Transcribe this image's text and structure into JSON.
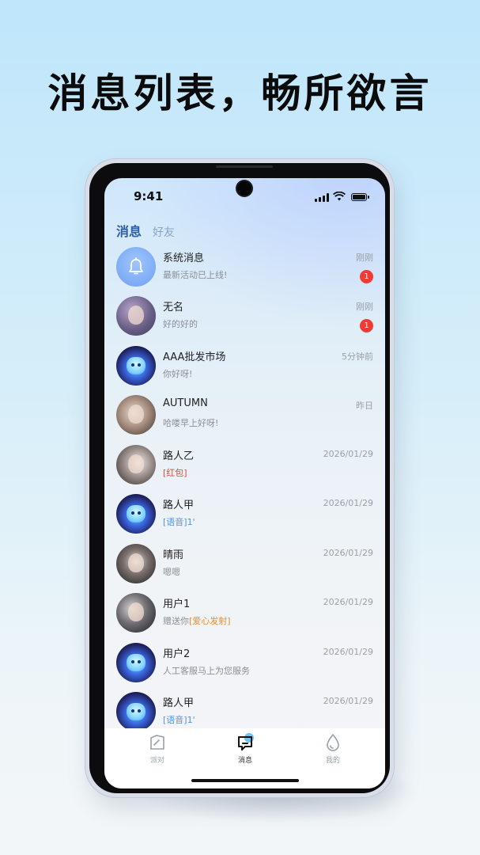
{
  "headline": "消息列表，畅所欲言",
  "status_bar": {
    "time": "9:41"
  },
  "tabs": [
    {
      "label": "消息",
      "active": true
    },
    {
      "label": "好友",
      "active": false
    }
  ],
  "conversations": [
    {
      "name": "系统消息",
      "preview": "最新活动已上线!",
      "time": "刚刚",
      "badge": "1",
      "avatar": "bell-icon"
    },
    {
      "name": "无名",
      "preview": "好的好的",
      "time": "刚刚",
      "badge": "1",
      "avatar": "avatar-photo"
    },
    {
      "name": "AAA批发市场",
      "preview": "你好呀!",
      "time": "5分钟前",
      "avatar": "robot-avatar"
    },
    {
      "name": "AUTUMN",
      "preview": "哈喽早上好呀!",
      "time": "昨日",
      "avatar": "avatar-photo"
    },
    {
      "name": "路人乙",
      "preview": "[红包]",
      "preview_style": "red",
      "time": "2026/01/29",
      "avatar": "avatar-photo"
    },
    {
      "name": "路人甲",
      "preview": "[语音]1'",
      "preview_style": "blue",
      "time": "2026/01/29",
      "avatar": "robot-avatar"
    },
    {
      "name": "晴雨",
      "preview": "嗯嗯",
      "time": "2026/01/29",
      "avatar": "avatar-photo"
    },
    {
      "name": "用户1",
      "preview_prefix": "赠送你",
      "preview_highlight": "[爱心发射]",
      "preview_style": "orange",
      "time": "2026/01/29",
      "avatar": "avatar-photo"
    },
    {
      "name": "用户2",
      "preview": "人工客服马上为您服务",
      "time": "2026/01/29",
      "avatar": "robot-avatar"
    },
    {
      "name": "路人甲",
      "preview": "[语音]1'",
      "preview_style": "blue",
      "time": "2026/01/29",
      "avatar": "robot-avatar"
    }
  ],
  "tabbar": [
    {
      "label": "派对",
      "icon": "party-icon",
      "active": false
    },
    {
      "label": "消息",
      "icon": "message-icon",
      "active": true
    },
    {
      "label": "我的",
      "icon": "profile-icon",
      "active": false
    }
  ],
  "colors": {
    "badge": "#ef3b33",
    "active_tab": "#2c5fa6",
    "red_tag": "#e0473f",
    "blue_tag": "#4e95e6",
    "orange_tag": "#f08a2c"
  }
}
